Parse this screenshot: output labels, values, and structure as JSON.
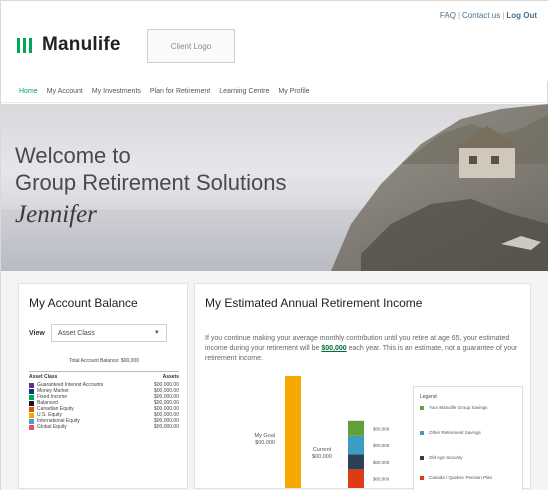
{
  "header": {
    "brand": "Manulife",
    "client_logo": "Client Logo",
    "links": {
      "faq": "FAQ",
      "contact": "Contact us",
      "logout": "Log Out"
    }
  },
  "nav": {
    "items": [
      {
        "label": "Home",
        "active": true
      },
      {
        "label": "My Account",
        "active": false
      },
      {
        "label": "My Investments",
        "active": false
      },
      {
        "label": "Plan for Retirement",
        "active": false
      },
      {
        "label": "Learning Centre",
        "active": false
      },
      {
        "label": "My Profile",
        "active": false
      }
    ]
  },
  "hero": {
    "line1": "Welcome to",
    "line2": "Group Retirement Solutions",
    "name": "Jennifer"
  },
  "account_balance": {
    "title": "My Account Balance",
    "view_label": "View",
    "view_value": "Asset Class",
    "total_label": "Total Account Balance: $00,000",
    "columns": [
      "Asset Class",
      "Assets"
    ],
    "rows": [
      {
        "name": "Guaranteed Interest Accounts",
        "amount": "$00,000.00",
        "color": "#6a2c91"
      },
      {
        "name": "Money Market",
        "amount": "$00,000.00",
        "color": "#003f7f"
      },
      {
        "name": "Fixed Income",
        "amount": "$00,000.00",
        "color": "#00a758"
      },
      {
        "name": "Balanced",
        "amount": "$00,000.00",
        "color": "#1a1a1a"
      },
      {
        "name": "Canadian Equity",
        "amount": "$00,000.00",
        "color": "#dc5a00"
      },
      {
        "name": "U.S. Equity",
        "amount": "$00,000.00",
        "color": "#f5a800"
      },
      {
        "name": "International Equity",
        "amount": "$00,000.00",
        "color": "#4a9fc7"
      },
      {
        "name": "Global Equity",
        "amount": "$00,000.00",
        "color": "#e84e6a"
      }
    ]
  },
  "income": {
    "title": "My Estimated Annual Retirement Income",
    "desc_before": "If you continue making your average monthly contribution until you retire at age 65, your estimated income during your retirement will be",
    "desc_amount": "$00,000",
    "desc_after": "each year. This is an estimate, not a guarantee of your retirement income."
  },
  "chart_data": {
    "type": "bar",
    "bars": [
      {
        "label_line1": "My Goal",
        "label_line2": "$00,000",
        "value": 30000,
        "color": "#f5a800"
      },
      {
        "label_line1": "Current",
        "label_line2": "$00,000",
        "stack": [
          {
            "value": 5000,
            "color": "#dc3b14"
          },
          {
            "value": 4000,
            "color": "#2e4057"
          },
          {
            "value": 5000,
            "color": "#3d9dc0"
          },
          {
            "value": 4000,
            "color": "#5fa03a"
          }
        ]
      }
    ],
    "stack_labels": [
      "$00,000",
      "$00,000",
      "$00,000",
      "$00,000"
    ],
    "legend": {
      "title": "Legend",
      "items": [
        {
          "label": "Your Manulife Group Savings",
          "color": "#5fa03a"
        },
        {
          "label": "Other Retirement Savings",
          "color": "#3d9dc0"
        },
        {
          "label": "Old Age Security",
          "color": "#2e4057"
        },
        {
          "label": "Canada / Quebec Pension Plan",
          "color": "#dc3b14"
        }
      ]
    },
    "ylim": [
      0,
      30000
    ]
  }
}
